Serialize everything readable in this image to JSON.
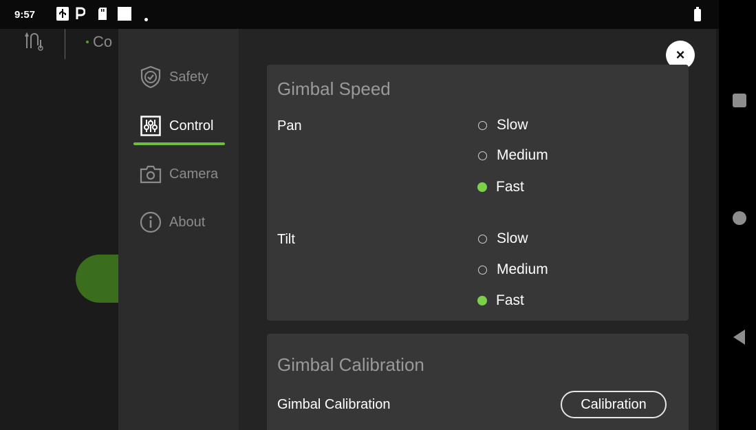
{
  "status_bar": {
    "time": "9:57",
    "icons": [
      "usb-icon",
      "parking-icon",
      "sd-card-icon",
      "square-notification-icon",
      "dot-icon",
      "battery-icon"
    ]
  },
  "background_app": {
    "title": "Co"
  },
  "sidebar": {
    "items": [
      {
        "label": "Safety",
        "icon": "shield-check-icon"
      },
      {
        "label": "Control",
        "icon": "sliders-icon",
        "active": true
      },
      {
        "label": "Camera",
        "icon": "camera-icon"
      },
      {
        "label": "About",
        "icon": "info-icon"
      }
    ]
  },
  "close_label": "×",
  "gimbal_speed": {
    "title": "Gimbal Speed",
    "pan": {
      "label": "Pan",
      "options": [
        "Slow",
        "Medium",
        "Fast"
      ],
      "selected": "Fast"
    },
    "tilt": {
      "label": "Tilt",
      "options": [
        "Slow",
        "Medium",
        "Fast"
      ],
      "selected": "Fast"
    }
  },
  "gimbal_calibration": {
    "title": "Gimbal Calibration",
    "row_label": "Gimbal Calibration",
    "button_label": "Calibration"
  },
  "colors": {
    "accent": "#7ccf4a",
    "modal_bg": "#242424",
    "card_bg": "#373737",
    "sidebar_bg": "#2c2c2c"
  }
}
